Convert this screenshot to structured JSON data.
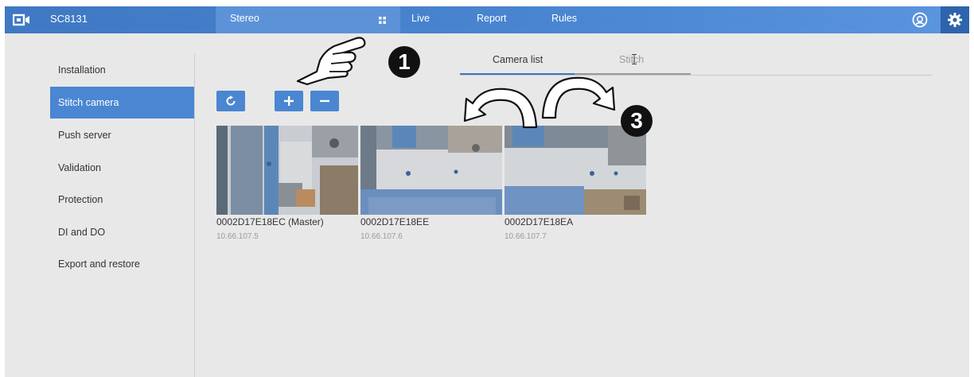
{
  "header": {
    "model": "SC8131",
    "nav": [
      {
        "label": "Stereo"
      },
      {
        "label": "Live"
      },
      {
        "label": "Report"
      },
      {
        "label": "Rules"
      }
    ]
  },
  "sidebar": {
    "items": [
      {
        "label": "Installation"
      },
      {
        "label": "Stitch camera",
        "active": true
      },
      {
        "label": "Push server"
      },
      {
        "label": "Validation"
      },
      {
        "label": "Protection"
      },
      {
        "label": "DI and DO"
      },
      {
        "label": "Export and restore"
      }
    ]
  },
  "tabs": [
    {
      "label": "Camera list",
      "active": true
    },
    {
      "label": "Stitch",
      "active": false
    }
  ],
  "cameras": [
    {
      "name": "0002D17E18EC (Master)",
      "ip": "10.66.107.5"
    },
    {
      "name": "0002D17E18EE",
      "ip": "10.66.107.6"
    },
    {
      "name": "0002D17E18EA",
      "ip": "10.66.107.7"
    }
  ],
  "annotations": {
    "step1": "1",
    "step3": "3"
  },
  "colors": {
    "accent": "#4a86d2",
    "header_dark": "#3f78c3",
    "background": "#e8e8e8"
  },
  "icons": [
    "logo-icon",
    "grid-icon",
    "user-icon",
    "gear-icon",
    "refresh-icon",
    "plus-icon",
    "minus-icon",
    "pointing-hand-icon",
    "curved-arrow-left-icon",
    "curved-arrow-right-icon",
    "text-cursor-icon"
  ]
}
